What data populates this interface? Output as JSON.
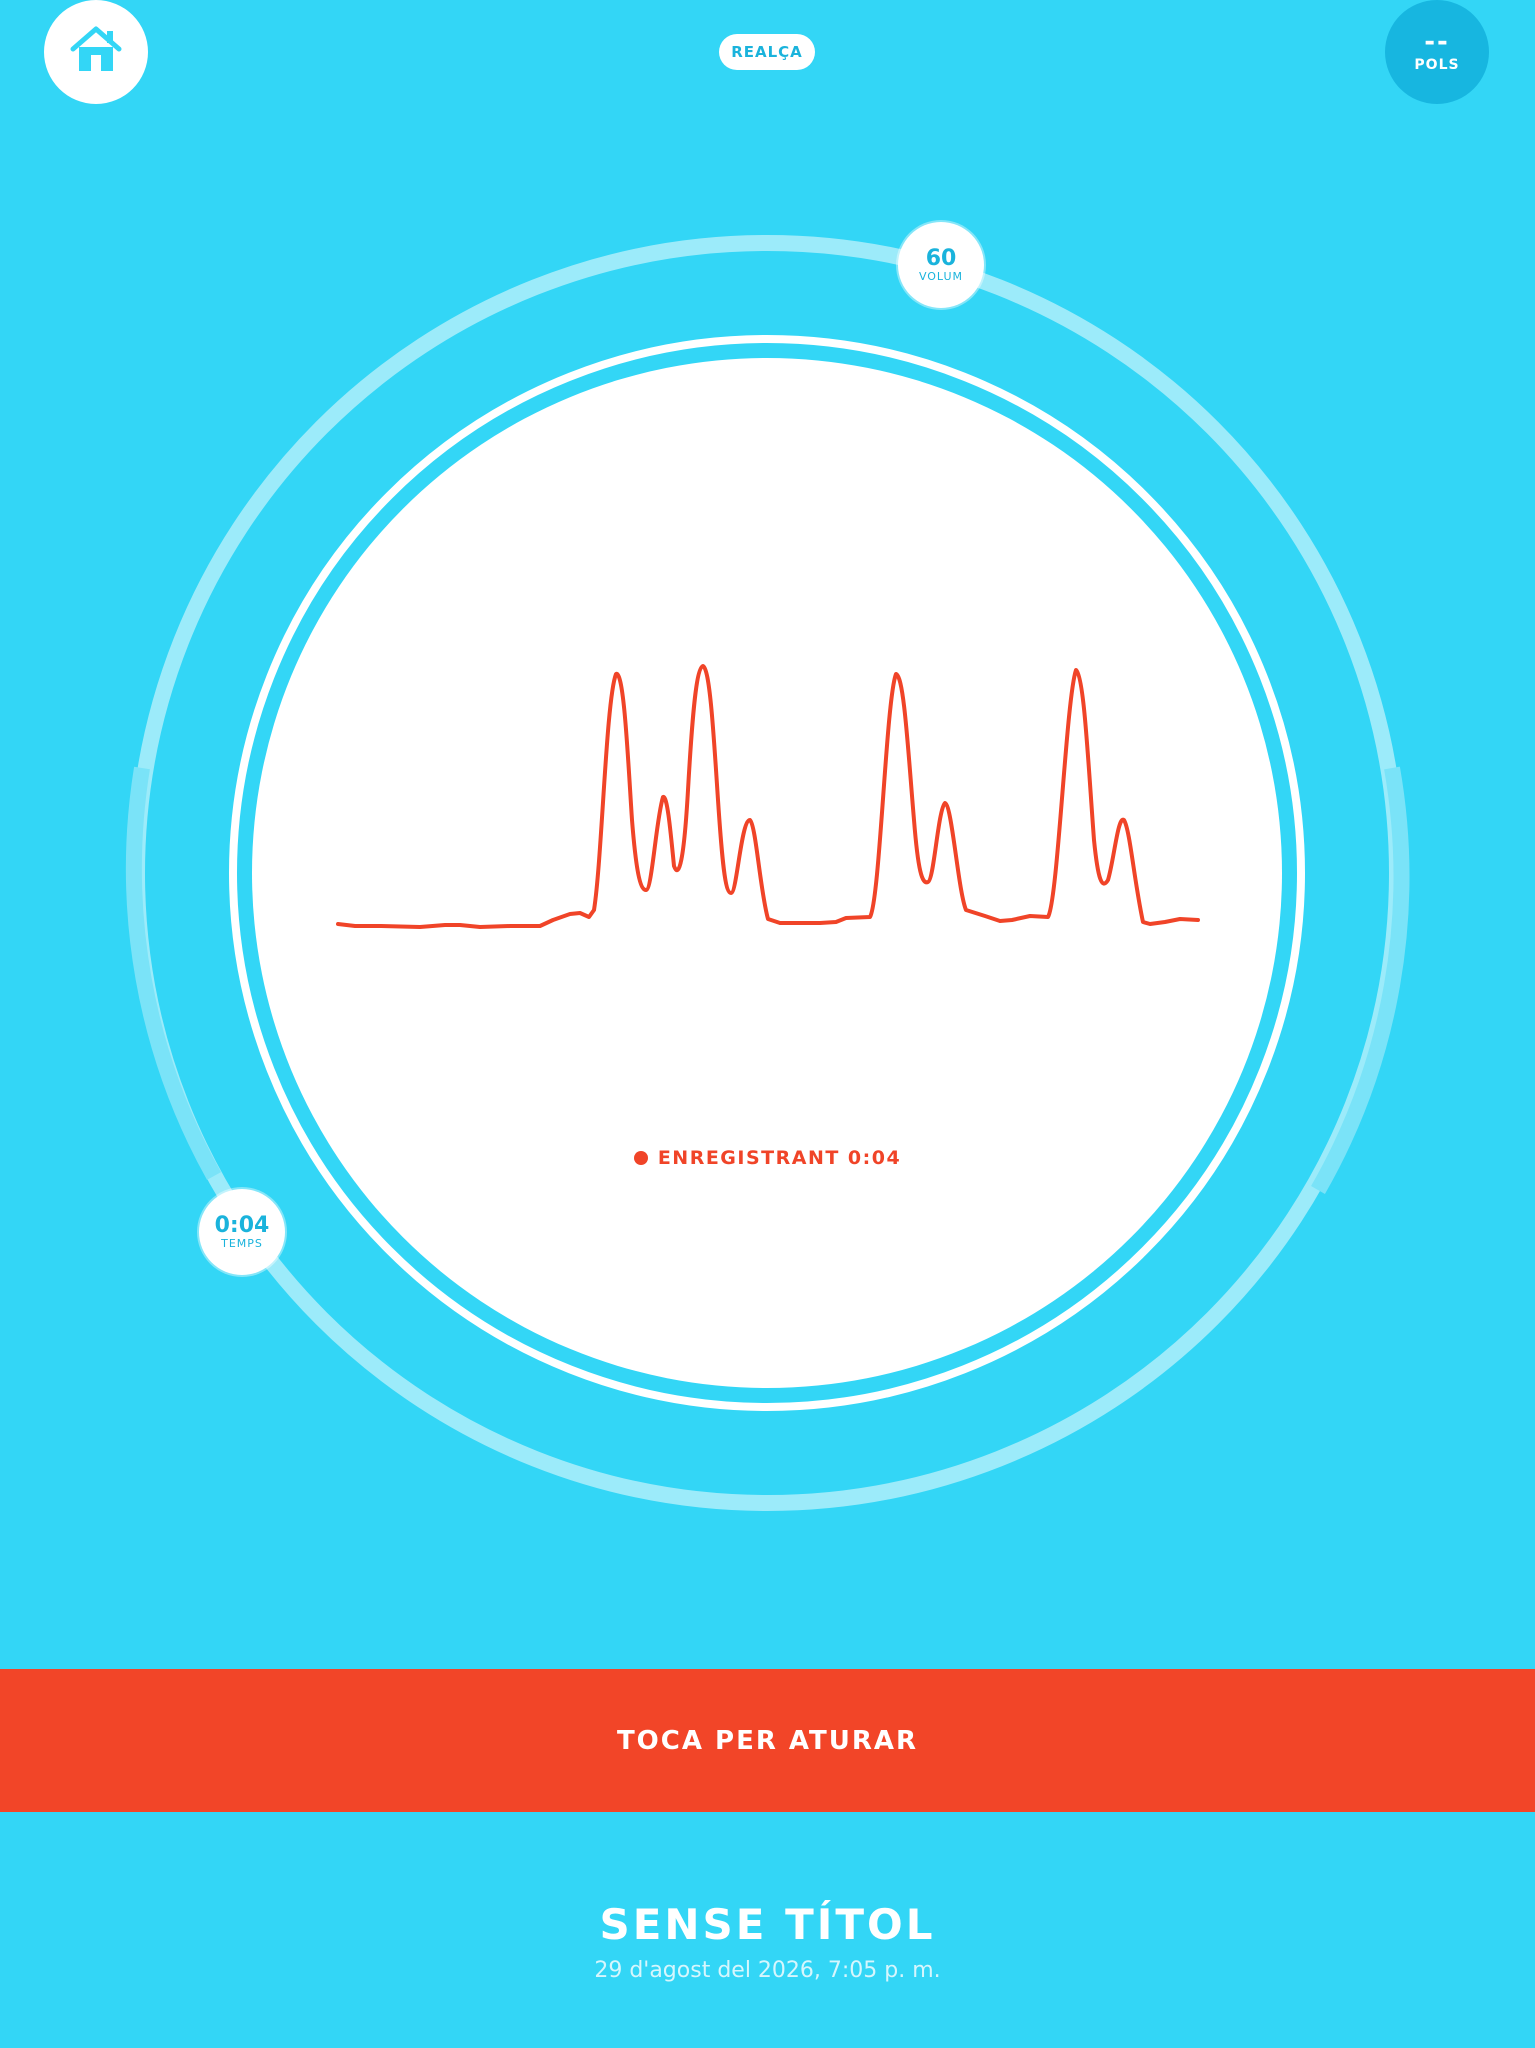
{
  "header": {
    "home_icon": "home-icon",
    "enhance_label": "REALÇA",
    "pulse_value": "--",
    "pulse_label": "POLS"
  },
  "dial": {
    "volume_value": "60",
    "volume_label": "VOLUM",
    "time_value": "0:04",
    "time_label": "TEMPS",
    "recording_status": "ENREGISTRANT 0:04"
  },
  "stop_button_label": "TOCA PER ATURAR",
  "recording": {
    "title": "SENSE TÍTOL",
    "date": "29 d'agost del 2026, 7:05 p. m."
  },
  "colors": {
    "background": "#33d6f6",
    "accent_red": "#f24528",
    "pulse_button": "#17b6e0",
    "waveform": "#f04428"
  }
}
